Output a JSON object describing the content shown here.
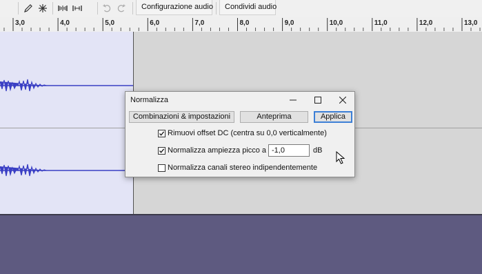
{
  "toolbar": {
    "effects_config_label": "Configurazione audio",
    "share_audio_label": "Condividi audio",
    "icons": [
      "pencil-icon",
      "multi-tool-icon",
      "trim-icon",
      "silence-icon",
      "undo-icon",
      "redo-icon"
    ]
  },
  "ruler": {
    "ticks": [
      "3,0",
      "4,0",
      "5,0",
      "6,0",
      "7,0",
      "8,0",
      "9,0",
      "10,0",
      "11,0",
      "12,0",
      "13,0"
    ]
  },
  "dialog": {
    "title": "Normalizza",
    "presets_button": "Combinazioni & impostazioni",
    "preview_button": "Anteprima",
    "apply_button": "Applica",
    "options": [
      {
        "label": "Rimuovi offset DC (centra su 0,0 verticalmente)",
        "checked": true
      },
      {
        "label": "Normalizza ampiezza picco a",
        "checked": true
      },
      {
        "label": "Normalizza canali stereo indipendentemente",
        "checked": false
      }
    ],
    "peak_value": "-1,0",
    "peak_unit": "dB"
  },
  "colors": {
    "waveform": "#3a3fc4",
    "selection": "#e3e4f6",
    "track_background": "#d6d6d6",
    "desktop": "#5e5a80",
    "default_button_border": "#3c7fd6"
  }
}
